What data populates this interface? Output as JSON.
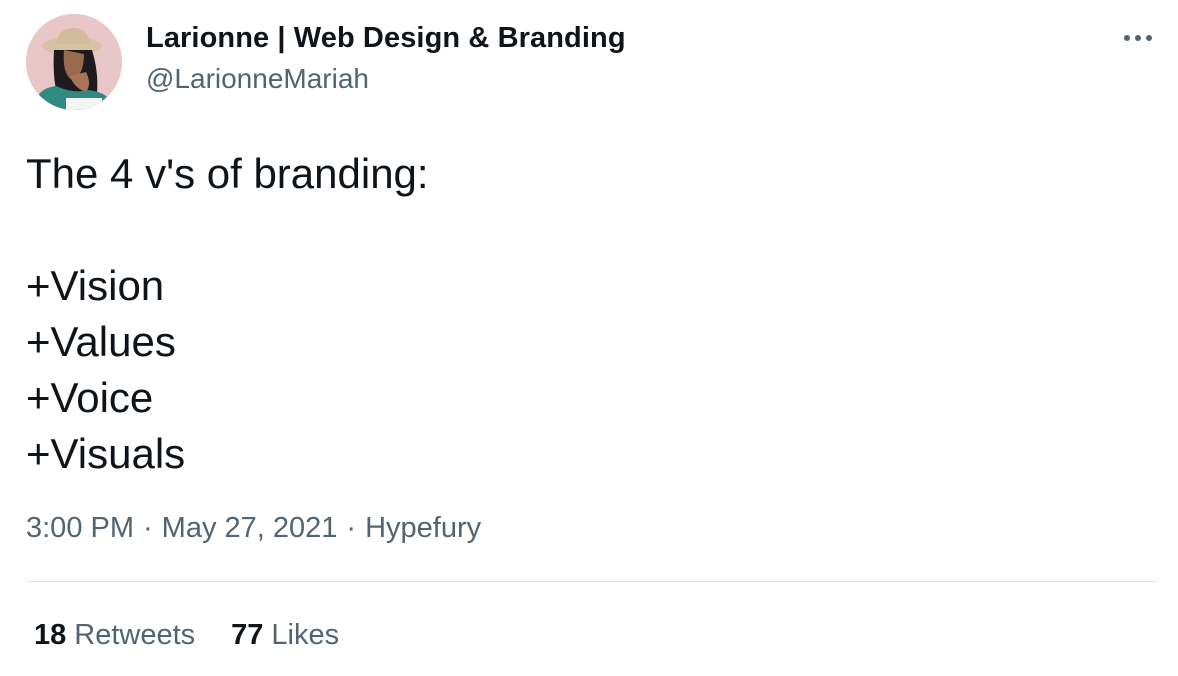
{
  "author": {
    "display_name": "Larionne | Web Design & Branding",
    "handle": "@LarionneMariah",
    "avatar_icon": "avatar-illustration"
  },
  "menu": {
    "icon": "more-horizontal-icon"
  },
  "tweet": {
    "lines": [
      "The 4 v's of branding:",
      "",
      "+Vision",
      "+Values",
      "+Voice",
      "+Visuals"
    ],
    "time": "3:00 PM",
    "date": "May 27, 2021",
    "source": "Hypefury",
    "separator": "·"
  },
  "stats": {
    "retweets_count": "18",
    "retweets_label": "Retweets",
    "likes_count": "77",
    "likes_label": "Likes"
  },
  "colors": {
    "text_primary": "#0f1419",
    "text_secondary": "#536471",
    "divider": "#e1e6ea",
    "avatar_bg": "#e9c6c8"
  }
}
